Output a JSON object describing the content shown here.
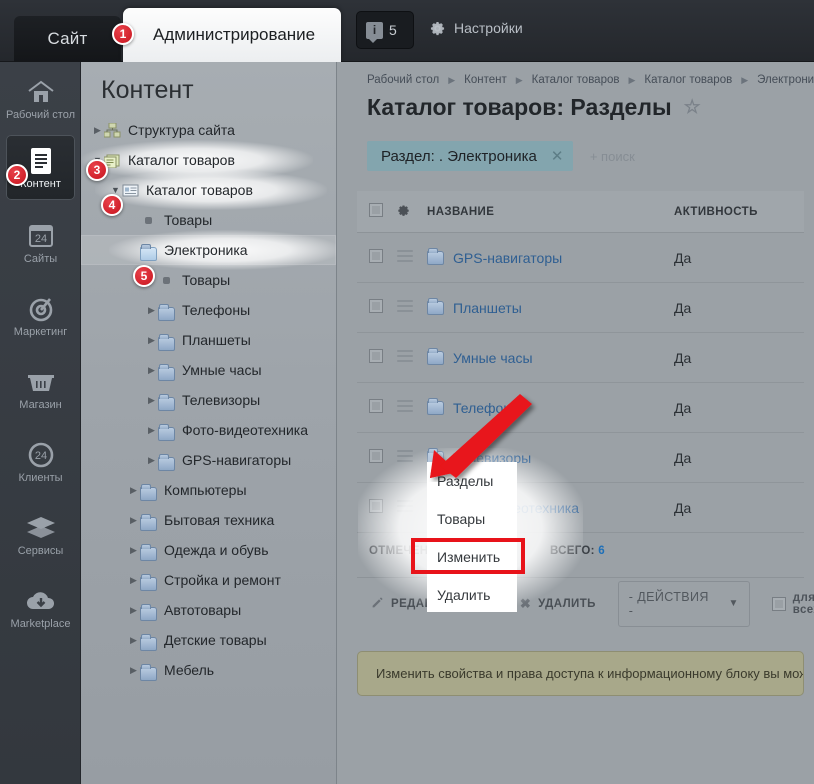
{
  "topbar": {
    "tab_site": "Сайт",
    "tab_admin": "Администрирование",
    "tab_admin_badge": "1",
    "counter": "5",
    "info_icon": "info-icon",
    "settings_label": "Настройки"
  },
  "rail": {
    "items": [
      {
        "label": "Рабочий стол",
        "icon": "home-icon",
        "active": false
      },
      {
        "label": "Контент",
        "icon": "document-icon",
        "active": true,
        "badge": "2"
      },
      {
        "label": "Сайты",
        "icon": "browser-24-icon",
        "active": false
      },
      {
        "label": "Маркетинг",
        "icon": "target-icon",
        "active": false
      },
      {
        "label": "Магазин",
        "icon": "basket-icon",
        "active": false
      },
      {
        "label": "Клиенты",
        "icon": "circle-24-icon",
        "active": false
      },
      {
        "label": "Сервисы",
        "icon": "layers-icon",
        "active": false
      },
      {
        "label": "Marketplace",
        "icon": "cloud-download-icon",
        "active": false
      }
    ]
  },
  "tree": {
    "title": "Контент",
    "nodes": [
      {
        "label": "Структура сайта",
        "indent": 0,
        "arrow": "closed",
        "icon": "sitemap-icon"
      },
      {
        "label": "Каталог товаров",
        "indent": 0,
        "arrow": "open",
        "icon": "iblock-icon",
        "badge": "3",
        "glow": true
      },
      {
        "label": "Каталог товаров",
        "indent": 1,
        "arrow": "open",
        "icon": "iblock-list-icon",
        "badge": "4",
        "glow": true
      },
      {
        "label": "Товары",
        "indent": 2,
        "arrow": "none",
        "icon": "dot-icon"
      },
      {
        "label": "Электроника",
        "indent": 2,
        "arrow": "none",
        "icon": "folder-light-icon",
        "badge": "5",
        "glow": true,
        "selected": true
      },
      {
        "label": "Товары",
        "indent": 3,
        "arrow": "none",
        "icon": "dot-icon"
      },
      {
        "label": "Телефоны",
        "indent": 3,
        "arrow": "closed",
        "icon": "folder-icon"
      },
      {
        "label": "Планшеты",
        "indent": 3,
        "arrow": "closed",
        "icon": "folder-icon"
      },
      {
        "label": "Умные часы",
        "indent": 3,
        "arrow": "closed",
        "icon": "folder-icon"
      },
      {
        "label": "Телевизоры",
        "indent": 3,
        "arrow": "closed",
        "icon": "folder-icon"
      },
      {
        "label": "Фото-видеотехника",
        "indent": 3,
        "arrow": "closed",
        "icon": "folder-icon"
      },
      {
        "label": "GPS-навигаторы",
        "indent": 3,
        "arrow": "closed",
        "icon": "folder-icon"
      },
      {
        "label": "Компьютеры",
        "indent": 2,
        "arrow": "closed",
        "icon": "folder-icon"
      },
      {
        "label": "Бытовая техника",
        "indent": 2,
        "arrow": "closed",
        "icon": "folder-icon"
      },
      {
        "label": "Одежда и обувь",
        "indent": 2,
        "arrow": "closed",
        "icon": "folder-icon"
      },
      {
        "label": "Стройка и ремонт",
        "indent": 2,
        "arrow": "closed",
        "icon": "folder-icon"
      },
      {
        "label": "Автотовары",
        "indent": 2,
        "arrow": "closed",
        "icon": "folder-icon"
      },
      {
        "label": "Детские товары",
        "indent": 2,
        "arrow": "closed",
        "icon": "folder-icon"
      },
      {
        "label": "Мебель",
        "indent": 2,
        "arrow": "closed",
        "icon": "folder-icon"
      }
    ]
  },
  "main": {
    "breadcrumb": [
      "Рабочий стол",
      "Контент",
      "Каталог товаров",
      "Каталог товаров",
      "Электроника"
    ],
    "title": "Каталог товаров: Разделы",
    "star_icon": "star-icon",
    "filter": {
      "chip_label": "Раздел: . Электроника",
      "chip_remove_icon": "close-icon",
      "add_search": "+ поиск"
    },
    "table": {
      "columns": [
        "НАЗВАНИЕ",
        "АКТИВНОСТЬ"
      ],
      "gear_icon": "gear-icon",
      "rows": [
        {
          "name": "GPS-навигаторы",
          "active": "Да"
        },
        {
          "name": "Планшеты",
          "active": "Да"
        },
        {
          "name": "Умные часы",
          "active": "Да"
        },
        {
          "name": "Телефоны",
          "active": "Да"
        },
        {
          "name": "Телевизоры",
          "active": "Да"
        },
        {
          "name": "Фото-видеотехника",
          "active": "Да"
        }
      ]
    },
    "totals": {
      "checked_label": "ОТМЕЧЕНО: 0",
      "total_label": "ВСЕГО:",
      "total_value": "6"
    },
    "actions": {
      "edit": "РЕДАКТИРОВАТЬ",
      "edit_icon": "pencil-icon",
      "delete": "УДАЛИТЬ",
      "delete_icon": "cross-icon",
      "select_value": "- ДЕЙСТВИЯ -",
      "select_icon": "chevron-down-icon",
      "for_all": "для всех"
    },
    "notice": "Изменить свойства и права доступа к информационному блоку вы можете"
  },
  "context_menu": {
    "items": [
      "Разделы",
      "Товары",
      "Изменить",
      "Удалить"
    ],
    "highlighted": "Изменить"
  },
  "annotations": {
    "arrow_color": "#e8131a",
    "badge_color": "#c8151f",
    "highlight_box_color": "#e8131a"
  }
}
